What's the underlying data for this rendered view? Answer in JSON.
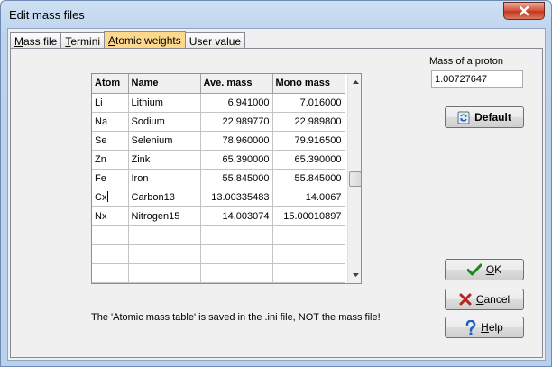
{
  "window": {
    "title": "Edit mass files"
  },
  "tabs": [
    {
      "label": "Mass file",
      "underline": "M",
      "rest": "ass file",
      "active": false
    },
    {
      "label": "Termini",
      "underline": "T",
      "rest": "ermini",
      "active": false
    },
    {
      "label": "Atomic weights",
      "underline": "A",
      "rest": "tomic weights",
      "active": true
    },
    {
      "label": "User value",
      "underline": "",
      "rest": "User value",
      "active": false
    }
  ],
  "grid": {
    "columns": [
      "Atom",
      "Name",
      "Ave. mass",
      "Mono mass"
    ],
    "rows": [
      [
        "Li",
        "Lithium",
        "6.941000",
        "7.016000"
      ],
      [
        "Na",
        "Sodium",
        "22.989770",
        "22.989800"
      ],
      [
        "Se",
        "Selenium",
        "78.960000",
        "79.916500"
      ],
      [
        "Zn",
        "Zink",
        "65.390000",
        "65.390000"
      ],
      [
        "Fe",
        "Iron",
        "55.845000",
        "55.845000"
      ],
      [
        "Cx",
        "Carbon13",
        "13.00335483",
        "14.0067"
      ],
      [
        "Nx",
        "Nitrogen15",
        "14.003074",
        "15.00010897"
      ],
      [
        "",
        "",
        "",
        ""
      ],
      [
        "",
        "",
        "",
        ""
      ],
      [
        "",
        "",
        "",
        ""
      ]
    ]
  },
  "note": "The 'Atomic mass table' is saved in the .ini file, NOT the mass file!",
  "proton": {
    "label": "Mass of a proton",
    "value": "1.00727647"
  },
  "buttons": {
    "default": {
      "underline": "",
      "rest": "Default"
    },
    "ok": {
      "underline": "O",
      "rest": "K"
    },
    "cancel": {
      "underline": "C",
      "rest": "ancel"
    },
    "help": {
      "underline": "H",
      "rest": "elp"
    }
  },
  "colors": {
    "active_tab": "#fcd78c",
    "ok_check": "#1a8a1a",
    "cancel_x": "#b3261e",
    "help_q": "#1f5fbf"
  }
}
